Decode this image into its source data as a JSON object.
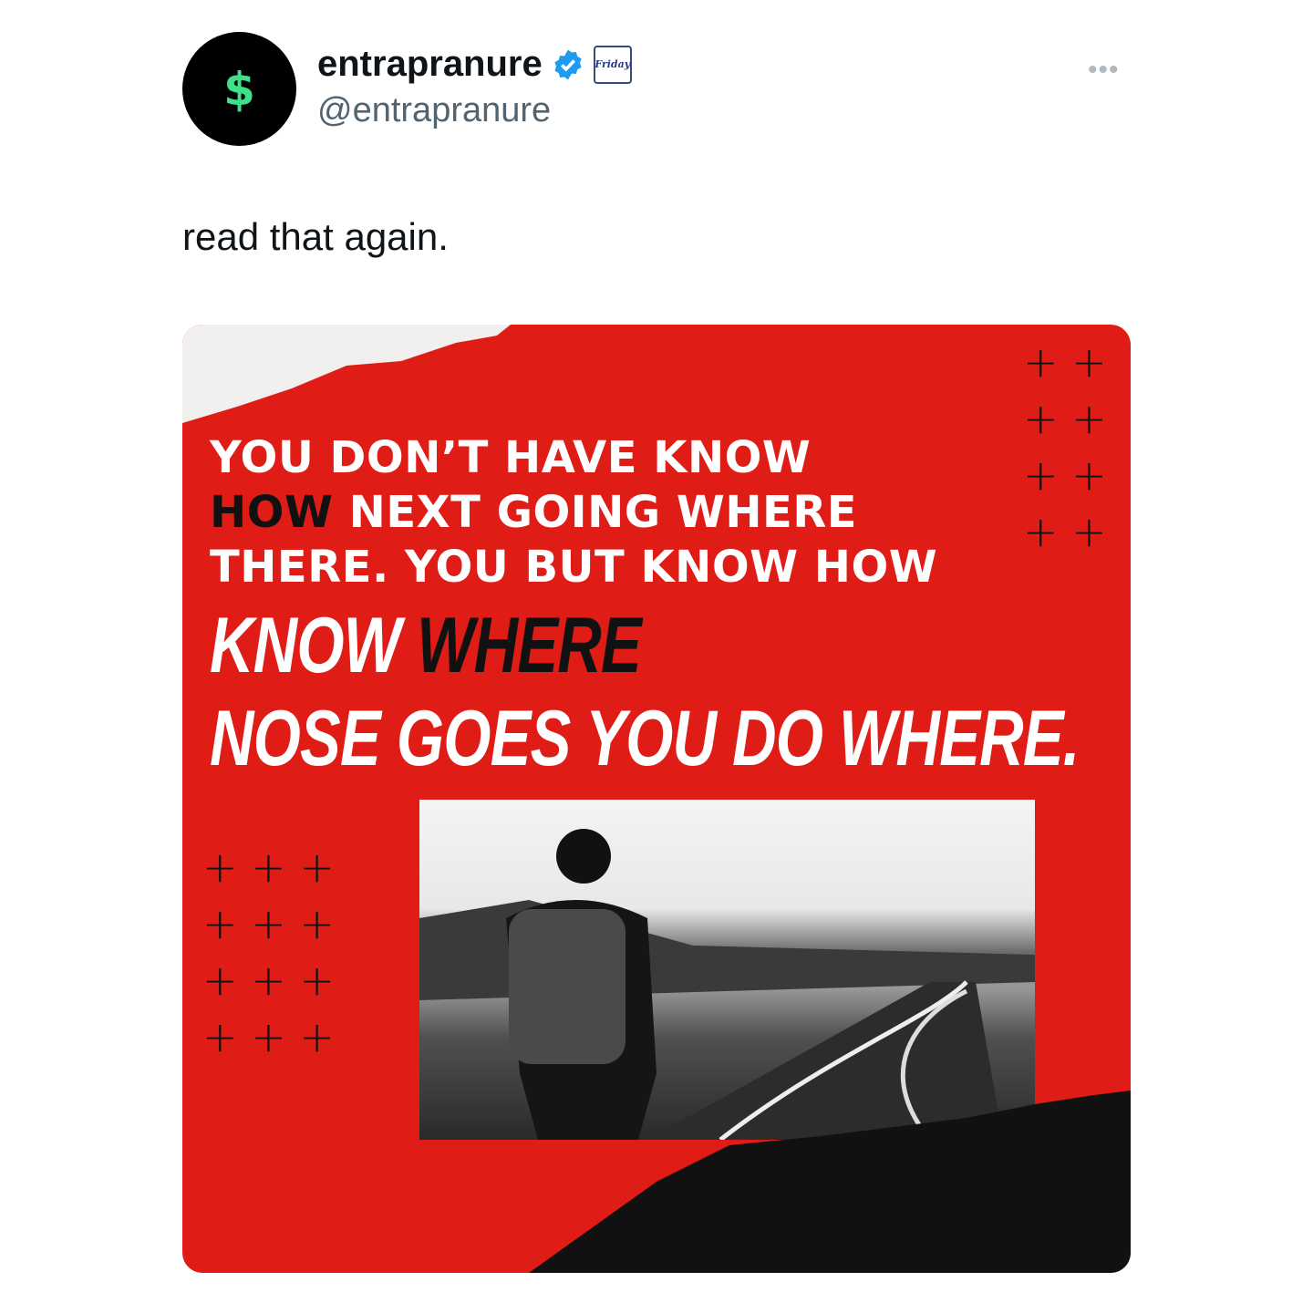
{
  "author": {
    "name": "entrapranure",
    "handle": "@entrapranure",
    "avatar_symbol": "$",
    "badge_text": "Friday"
  },
  "tweet": {
    "text": "read that again."
  },
  "image": {
    "lines": [
      "YOU DON’T HAVE KNOW",
      "HOW",
      "NEXT GOING WHERE",
      "THERE. YOU BUT KNOW HOW"
    ],
    "big_lines": [
      "KNOW",
      "WHERE",
      "NOSE GOES YOU DO WHERE."
    ]
  },
  "colors": {
    "accent_red": "#e01c16",
    "verified_blue": "#1d9bf0",
    "avatar_green": "#3ee08a"
  }
}
